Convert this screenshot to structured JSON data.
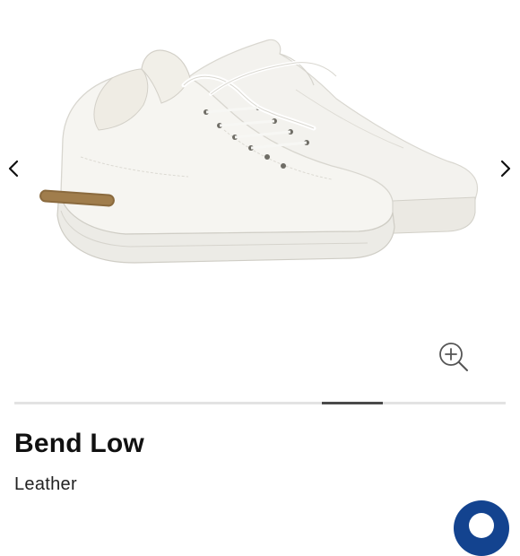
{
  "product": {
    "name": "Bend Low",
    "material": "Leather"
  },
  "gallery": {
    "prev_icon": "chevron-left-icon",
    "next_icon": "chevron-right-icon",
    "zoom_icon": "zoom-in-icon",
    "image_description_icon": "white-leather-sneakers",
    "position": 6,
    "total": 8
  },
  "chat": {
    "icon": "chat-bubble-icon",
    "color": "#13438f"
  },
  "colors": {
    "progress_track": "#e3e3e3",
    "progress_thumb": "#4a4a4a",
    "sole_cork": "#8a6a3e"
  }
}
